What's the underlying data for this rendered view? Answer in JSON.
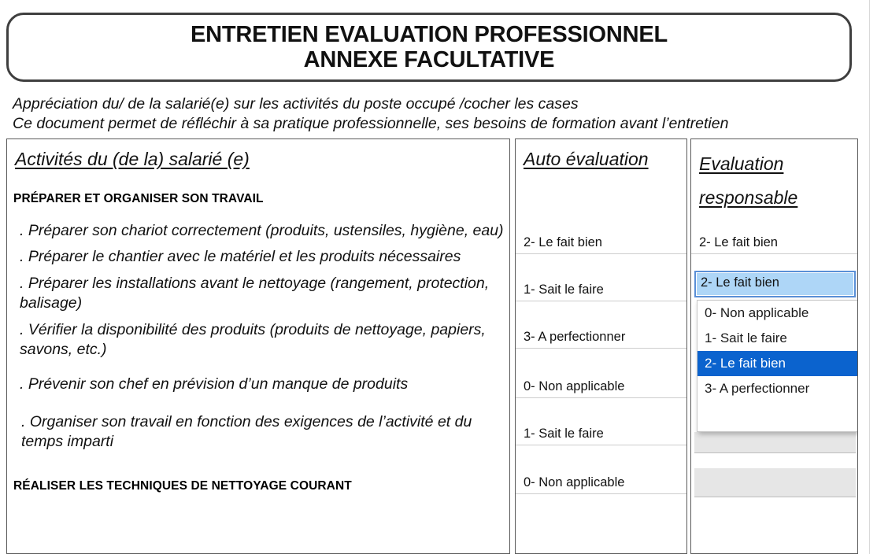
{
  "title": {
    "line1": "ENTRETIEN EVALUATION PROFESSIONNEL",
    "line2": "ANNEXE FACULTATIVE"
  },
  "intro": {
    "line1": "Appréciation du/ de la salarié(e) sur les activités du poste occupé /cocher les cases",
    "line2": "Ce document permet de réfléchir à sa pratique professionnelle, ses besoins de formation avant l’entretien"
  },
  "table": {
    "headers": {
      "activities": "Activités du (de la) salarié (e)",
      "auto": "Auto évaluation",
      "responsable": "Evaluation responsable"
    },
    "activities_column": {
      "section1_title": "PRÉPARER ET ORGANISER SON TRAVAIL",
      "items": [
        ". Préparer son chariot correctement (produits, ustensiles, hygiène, eau)",
        ". Préparer le chantier avec le matériel et les produits nécessaires",
        ". Préparer les installations avant le nettoyage (rangement, protection, balisage)",
        ". Vérifier la disponibilité des produits (produits de nettoyage, papiers, savons, etc.)",
        ". Prévenir son chef en prévision d’un manque de produits",
        ". Organiser son travail en fonction des exigences de l’activité et du temps imparti"
      ],
      "section2_title": "RÉALISER LES TECHNIQUES DE NETTOYAGE COURANT"
    },
    "auto_evaluation_values": [
      "2- Le fait bien",
      "1- Sait le faire",
      "3- A perfectionner",
      "0- Non applicable",
      "1- Sait le faire",
      "0- Non applicable"
    ],
    "responsable_values": [
      "2- Le fait bien"
    ]
  },
  "dropdown": {
    "selected_value": "2- Le fait bien",
    "options": [
      "0- Non applicable",
      "1- Sait le faire",
      "2- Le fait bien",
      "3- A perfectionner"
    ],
    "highlighted_option": "2- Le fait bien",
    "highlight_color": "#0b63ce",
    "combo_background": "#aed6f7",
    "combo_border": "#5a8fd6"
  }
}
